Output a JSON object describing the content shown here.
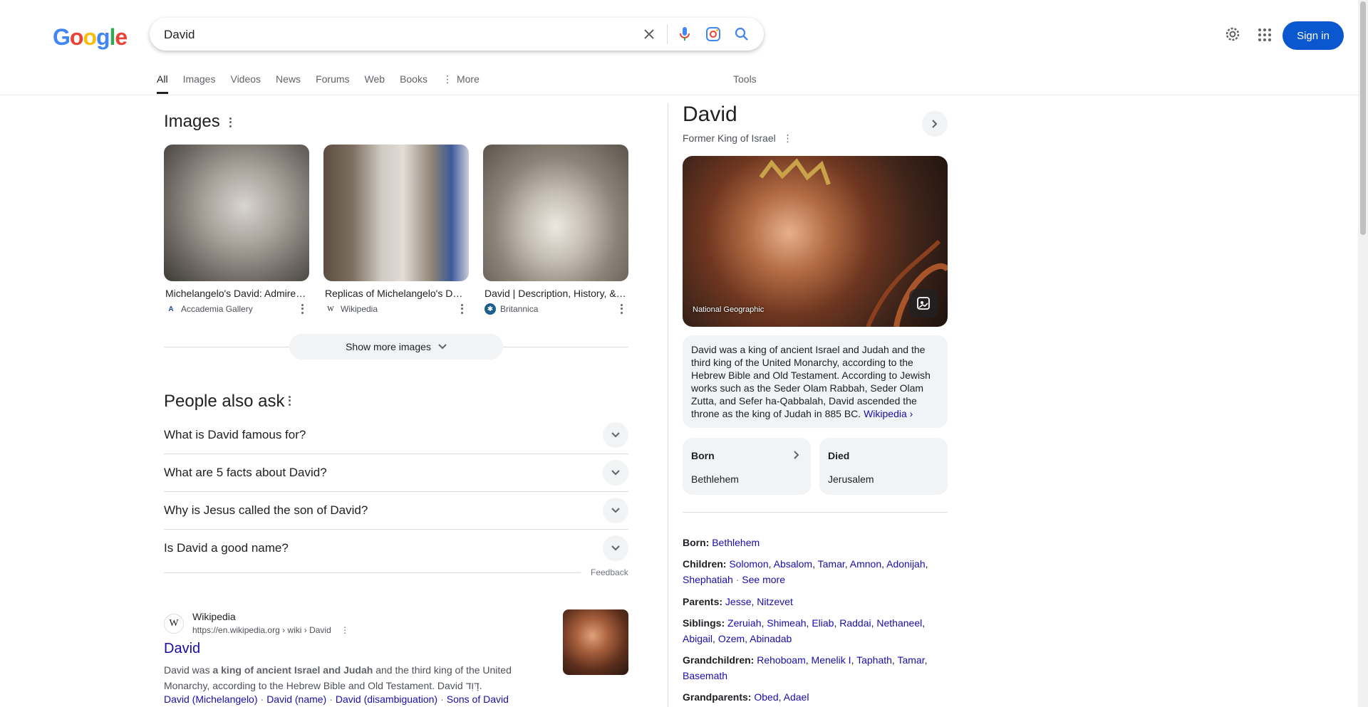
{
  "header": {
    "logo": "Google",
    "query": "David",
    "sign_in": "Sign in"
  },
  "tabs": [
    "All",
    "Images",
    "Videos",
    "News",
    "Forums",
    "Web",
    "Books",
    "More"
  ],
  "tools": "Tools",
  "images_section": {
    "title": "Images",
    "items": [
      {
        "caption": "Michelangelo's David: Admired for its ...",
        "source": "Accademia Gallery"
      },
      {
        "caption": "Replicas of Michelangelo's David ...",
        "source": "Wikipedia"
      },
      {
        "caption": "David | Description, History, & Facts ...",
        "source": "Britannica"
      }
    ],
    "show_more": "Show more images"
  },
  "people_also_ask": {
    "title": "People also ask",
    "questions": [
      "What is David famous for?",
      "What are 5 facts about David?",
      "Why is Jesus called the son of David?",
      "Is David a good name?"
    ],
    "feedback": "Feedback"
  },
  "result": {
    "site": "Wikipedia",
    "url": "https://en.wikipedia.org › wiki › David",
    "title": "David",
    "snippet_pre": "David was ",
    "snippet_bold": "a king of ancient Israel and Judah",
    "snippet_post": " and the third king of the United Monarchy, according to the Hebrew Bible and Old Testament. David דָּוִד.",
    "links": [
      "David (Michelangelo)",
      "David (name)",
      "David (disambiguation)",
      "Sons of David"
    ]
  },
  "knowledge_panel": {
    "title": "David",
    "subtitle": "Former King of Israel",
    "image_credit": "National Geographic",
    "description": "David was a king of ancient Israel and Judah and the third king of the United Monarchy, according to the Hebrew Bible and Old Testament. According to Jewish works such as the Seder Olam Rabbah, Seder Olam Zutta, and Sefer ha-Qabbalah, David ascended the throne as the king of Judah in 885 BC.",
    "description_link": "Wikipedia ›",
    "born_label": "Born",
    "born_value": "Bethlehem",
    "died_label": "Died",
    "died_value": "Jerusalem",
    "facts": {
      "born": {
        "label": "Born:",
        "values": [
          "Bethlehem"
        ]
      },
      "children": {
        "label": "Children:",
        "values": [
          "Solomon",
          "Absalom",
          "Tamar",
          "Amnon",
          "Adonijah",
          "Shephatiah"
        ],
        "more": "See more"
      },
      "parents": {
        "label": "Parents:",
        "values": [
          "Jesse",
          "Nitzevet"
        ]
      },
      "siblings": {
        "label": "Siblings:",
        "values": [
          "Zeruiah",
          "Shimeah",
          "Eliab",
          "Raddai",
          "Nethaneel",
          "Abigail",
          "Ozem",
          "Abinadab"
        ]
      },
      "grandchildren": {
        "label": "Grandchildren:",
        "values": [
          "Rehoboam",
          "Menelik I",
          "Taphath",
          "Tamar",
          "Basemath"
        ]
      },
      "grandparents": {
        "label": "Grandparents:",
        "values": [
          "Obed",
          "Adael"
        ]
      }
    }
  }
}
